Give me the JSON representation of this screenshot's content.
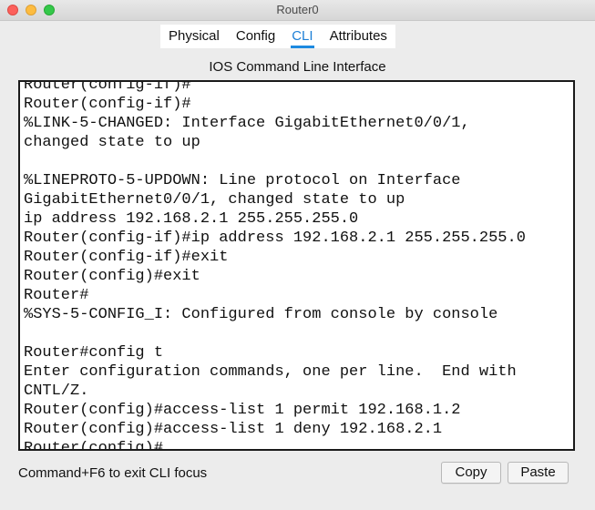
{
  "window": {
    "title": "Router0"
  },
  "tabs": [
    {
      "label": "Physical",
      "active": false
    },
    {
      "label": "Config",
      "active": false
    },
    {
      "label": "CLI",
      "active": true
    },
    {
      "label": "Attributes",
      "active": false
    }
  ],
  "panel": {
    "title": "IOS Command Line Interface",
    "hint": "Command+F6 to exit CLI focus",
    "copy_label": "Copy",
    "paste_label": "Paste"
  },
  "terminal": {
    "lines": [
      "Router(config-if)#",
      "Router(config-if)#",
      "%LINK-5-CHANGED: Interface GigabitEthernet0/0/1,",
      "changed state to up",
      "",
      "%LINEPROTO-5-UPDOWN: Line protocol on Interface",
      "GigabitEthernet0/0/1, changed state to up",
      "ip address 192.168.2.1 255.255.255.0",
      "Router(config-if)#ip address 192.168.2.1 255.255.255.0",
      "Router(config-if)#exit",
      "Router(config)#exit",
      "Router#",
      "%SYS-5-CONFIG_I: Configured from console by console",
      "",
      "Router#config t",
      "Enter configuration commands, one per line.  End with",
      "CNTL/Z.",
      "Router(config)#access-list 1 permit 192.168.1.2",
      "Router(config)#access-list 1 deny 192.168.2.1",
      "Router(config)#"
    ]
  },
  "colors": {
    "accent": "#1d8ae0",
    "close": "#fc605b",
    "minimize": "#fdbc40",
    "maximize": "#34c84a"
  }
}
